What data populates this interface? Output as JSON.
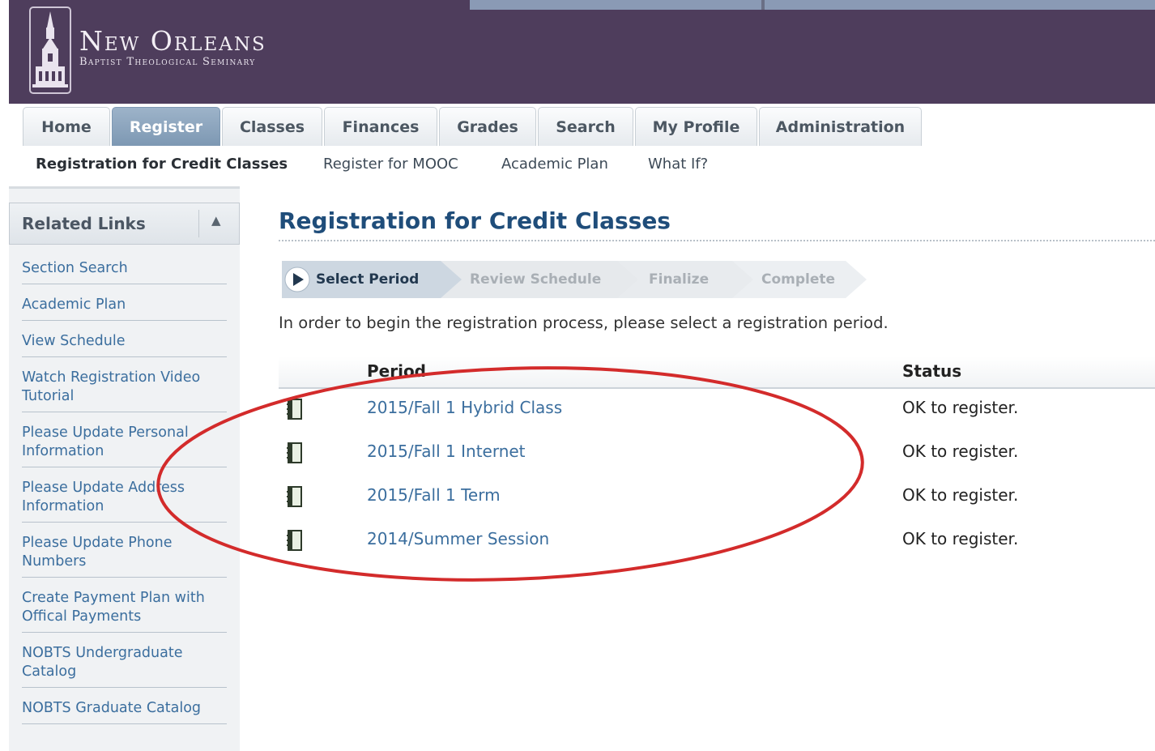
{
  "header": {
    "title": "New Orleans",
    "subtitle": "Baptist Theological Seminary"
  },
  "tabs": [
    {
      "label": "Home",
      "active": false
    },
    {
      "label": "Register",
      "active": true
    },
    {
      "label": "Classes",
      "active": false
    },
    {
      "label": "Finances",
      "active": false
    },
    {
      "label": "Grades",
      "active": false
    },
    {
      "label": "Search",
      "active": false
    },
    {
      "label": "My Profile",
      "active": false
    },
    {
      "label": "Administration",
      "active": false
    }
  ],
  "subnav": [
    {
      "label": "Registration for Credit Classes",
      "active": true
    },
    {
      "label": "Register for MOOC",
      "active": false
    },
    {
      "label": "Academic Plan",
      "active": false
    },
    {
      "label": "What If?",
      "active": false
    }
  ],
  "sidebar": {
    "title": "Related Links",
    "collapse_icon": "▲",
    "links": [
      "Section Search",
      "Academic Plan",
      "View Schedule",
      "Watch Registration Video Tutorial",
      "Please Update Personal Information",
      "Please Update Address Information",
      "Please Update Phone Numbers",
      "Create Payment Plan with Offical Payments",
      "NOBTS Undergraduate Catalog",
      "NOBTS Graduate Catalog"
    ]
  },
  "main": {
    "title": "Registration for Credit Classes",
    "steps": [
      {
        "label": "Select Period",
        "active": true
      },
      {
        "label": "Review Schedule",
        "active": false
      },
      {
        "label": "Finalize",
        "active": false
      },
      {
        "label": "Complete",
        "active": false
      }
    ],
    "instructions": "In order to begin the registration process, please select a registration period.",
    "table": {
      "headers": {
        "period": "Period",
        "status": "Status"
      },
      "rows": [
        {
          "period": "2015/Fall 1 Hybrid Class",
          "status": "OK to register."
        },
        {
          "period": "2015/Fall 1 Internet",
          "status": "OK to register."
        },
        {
          "period": "2015/Fall 1 Term",
          "status": "OK to register."
        },
        {
          "period": "2014/Summer Session",
          "status": "OK to register."
        }
      ]
    }
  },
  "colors": {
    "header_bg": "#4e3d5c",
    "active_tab": "#7d98b3",
    "link": "#3b6e9e",
    "title": "#1f4d7a",
    "annotation": "#d32b2b"
  }
}
